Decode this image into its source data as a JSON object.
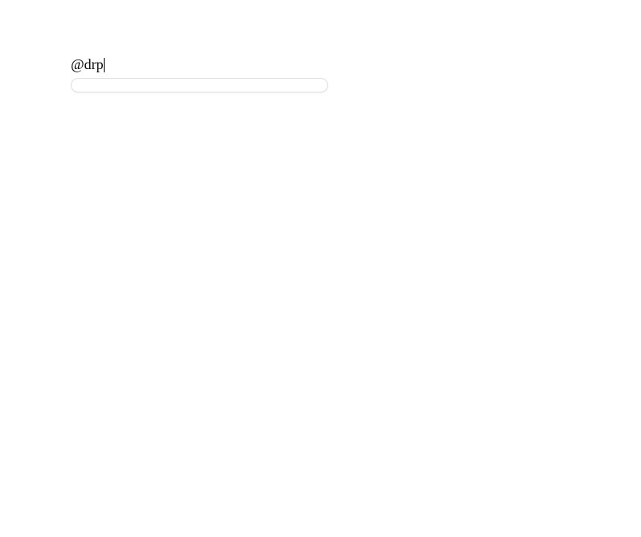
{
  "form": {
    "label": "@drp",
    "input_value": "",
    "input_placeholder": ""
  }
}
